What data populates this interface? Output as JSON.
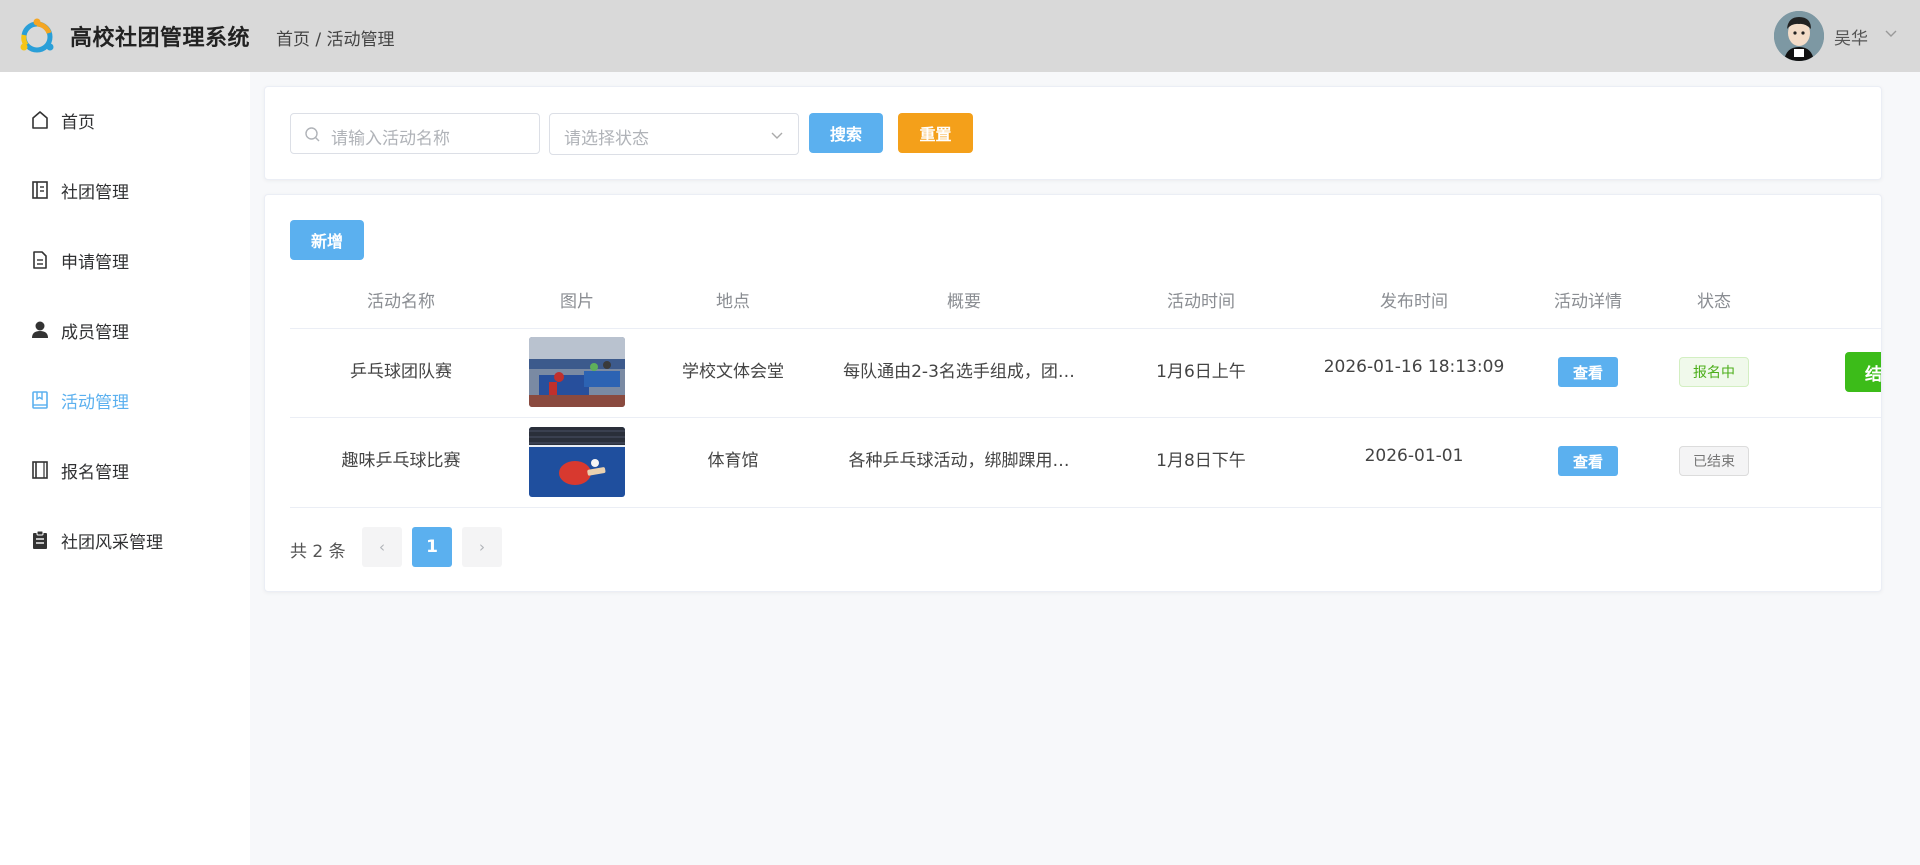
{
  "header": {
    "app_title": "高校社团管理系统",
    "breadcrumb": "首页 / 活动管理",
    "username": "吴华"
  },
  "sidebar": {
    "items": [
      {
        "label": "首页",
        "icon": "home-icon"
      },
      {
        "label": "社团管理",
        "icon": "notebook-icon"
      },
      {
        "label": "申请管理",
        "icon": "document-icon"
      },
      {
        "label": "成员管理",
        "icon": "user-icon"
      },
      {
        "label": "活动管理",
        "icon": "book-icon",
        "active": true
      },
      {
        "label": "报名管理",
        "icon": "notebook-icon"
      },
      {
        "label": "社团风采管理",
        "icon": "clipboard-icon"
      }
    ]
  },
  "search": {
    "name_placeholder": "请输入活动名称",
    "status_placeholder": "请选择状态",
    "search_label": "搜索",
    "reset_label": "重置"
  },
  "table": {
    "add_label": "新增",
    "columns": [
      "活动名称",
      "图片",
      "地点",
      "概要",
      "活动时间",
      "发布时间",
      "活动详情",
      "状态"
    ],
    "rows": [
      {
        "name": "乒乓球团队赛",
        "location": "学校文体会堂",
        "summary": "每队通由2-3名选手组成，团…",
        "activity_time": "1月6日上午",
        "publish_time": "2026-01-16 18:13:09",
        "detail_label": "查看",
        "status": "报名中",
        "action_label": "结"
      },
      {
        "name": "趣味乒乓球比赛",
        "location": "体育馆",
        "summary": "各种乒乓球活动，绑脚踝用…",
        "activity_time": "1月8日下午",
        "publish_time": "2026-01-01",
        "detail_label": "查看",
        "status": "已结束"
      }
    ]
  },
  "pagination": {
    "total_text": "共 2 条",
    "current_page": "1",
    "prev": "‹",
    "next": "›"
  },
  "colors": {
    "primary": "#5bb0ef",
    "warning": "#f4a01a",
    "success": "#3cbc19",
    "header_bg": "#d9d9d9"
  }
}
